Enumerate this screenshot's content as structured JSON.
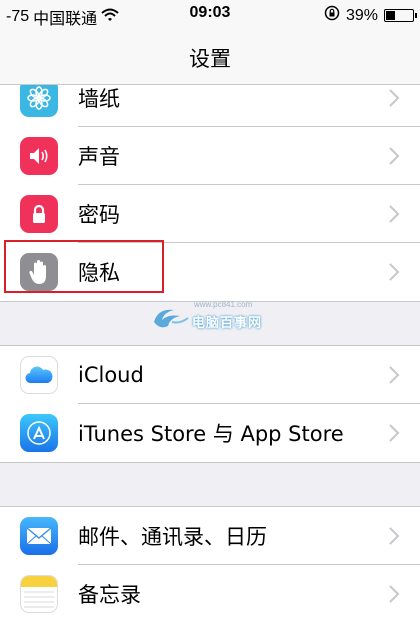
{
  "status_bar": {
    "signal": "-75",
    "carrier": "中国联通",
    "time": "09:03",
    "battery_percent": "39%",
    "battery_level": 0.39,
    "icons": [
      "wifi-icon",
      "rotation-lock-icon",
      "battery-icon"
    ]
  },
  "nav": {
    "title": "设置"
  },
  "group1": {
    "items": [
      {
        "label": "墙纸",
        "icon": "wallpaper-icon",
        "color": "#3ab7e3"
      },
      {
        "label": "声音",
        "icon": "sound-icon",
        "color": "#f0325a"
      },
      {
        "label": "密码",
        "icon": "passcode-lock-icon",
        "color": "#f0325a"
      },
      {
        "label": "隐私",
        "icon": "privacy-hand-icon",
        "color": "#8e8e93"
      }
    ]
  },
  "watermark": {
    "url": "www.pc841.com",
    "text": "电脑百事网"
  },
  "group2": {
    "items": [
      {
        "label": "iCloud",
        "icon": "icloud-icon",
        "color": "#3aa0f0"
      },
      {
        "label": "iTunes Store 与 App Store",
        "icon": "app-store-icon",
        "color": "#1a8ff0"
      }
    ]
  },
  "group3": {
    "items": [
      {
        "label": "邮件、通讯录、日历",
        "icon": "mail-icon",
        "color": "#2d8cf0"
      },
      {
        "label": "备忘录",
        "icon": "notes-icon",
        "color": "#f7d23e"
      }
    ]
  },
  "colors": {
    "background": "#efeff4",
    "separator": "#c8c7cc",
    "chevron": "#c7c7cc",
    "highlight": "#d9202a"
  }
}
